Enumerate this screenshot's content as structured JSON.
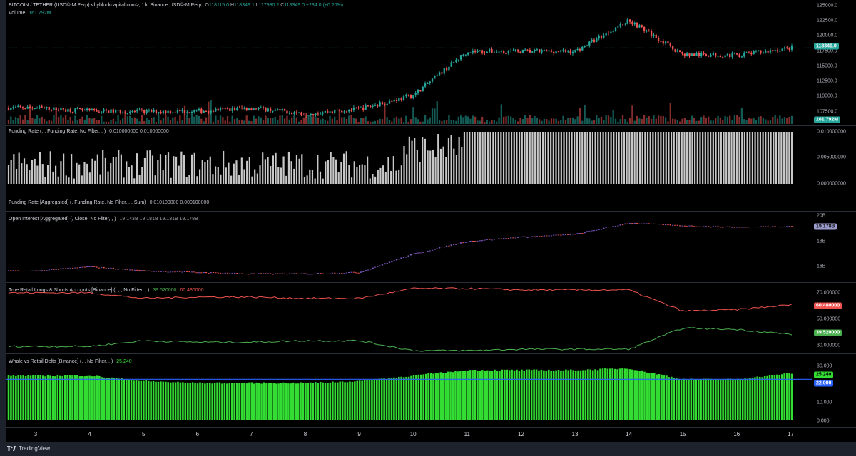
{
  "price_pane": {
    "title": "BITCOIN / TETHER (USD©-M Perp) <hyblockcapital.com>, 1h, Binance USD©-M Perp",
    "ohlc": [
      {
        "label": "O",
        "value": "118115.0"
      },
      {
        "label": "H",
        "value": "118349.1"
      },
      {
        "label": "L",
        "value": "117980.2"
      },
      {
        "label": "C",
        "value": "118349.0"
      }
    ],
    "change": "+234.0 (+0.20%)",
    "volume_label": "Volume",
    "volume_value": "161.792M",
    "ticks": [
      "125000.0",
      "122500.0",
      "120000.0",
      "117500.0",
      "115000.0",
      "112500.0",
      "110000.0",
      "107500.0"
    ],
    "last_price_badge": "118349.0",
    "volume_badge": "161.792M"
  },
  "funding_pane": {
    "title": "Funding Rate (, , Funding Rate, No Filter, , )",
    "values": "0.010000000  0.010000000",
    "ticks": [
      "0.010000000",
      "0.005000000",
      "0.000000000"
    ]
  },
  "agg_funding_pane": {
    "title": "Funding Rate [Aggregated] (, Funding Rate, No Filter, , , Sum)",
    "values": "0.010100000  0.000100000"
  },
  "oi_pane": {
    "title": "Open Interest [Aggregated] (, Close, No Filter, , )",
    "values": "19.143B  19.181B  19.131B  19.178B",
    "ticks": [
      "20B",
      "18B",
      "16B"
    ],
    "badge": "19.178B"
  },
  "retail_pane": {
    "title": "True Retail Longs & Shorts Accounts [Binance] (, , , No Filter, , )",
    "value_green": "39.520000",
    "value_red": "60.480000",
    "ticks": [
      "70.000000",
      "50.000000",
      "30.000000"
    ],
    "badge_red": "60.480000",
    "badge_green": "39.520000"
  },
  "delta_pane": {
    "title": "Whale vs Retail Delta [Binance] (, , No Filter, , )",
    "value": "25.240",
    "ticks": [
      "30.000",
      "10.000",
      "0.000"
    ],
    "badge_value": "25.240",
    "badge_line": "22.000"
  },
  "time_axis": [
    "3",
    "4",
    "5",
    "6",
    "7",
    "8",
    "9",
    "10",
    "11",
    "12",
    "13",
    "14",
    "15",
    "16",
    "17"
  ],
  "branding": "TradingView",
  "colors": {
    "up": "#26a69a",
    "down": "#ef5350",
    "oi_bar": "#7e57c2",
    "retail_long": "#4caf50",
    "retail_short": "#ef5350",
    "delta": "#33dd33",
    "delta_line": "#2962ff"
  },
  "chart_data": [
    {
      "type": "line",
      "title": "BITCOIN / TETHER (USD©-M Perp), 1h",
      "x": [
        "3",
        "4",
        "5",
        "6",
        "7",
        "8",
        "9",
        "10",
        "11",
        "12",
        "13",
        "14",
        "15",
        "16",
        "17"
      ],
      "series": [
        {
          "values": [
            108800,
            108300,
            108200,
            108300,
            108800,
            107900,
            108600,
            110800,
            117800,
            117800,
            117800,
            122800,
            117300,
            117200,
            118349
          ]
        }
      ],
      "ylim": [
        106000,
        126000
      ]
    },
    {
      "type": "line",
      "title": "Open Interest [Aggregated]",
      "x": [
        "3",
        "4",
        "5",
        "6",
        "7",
        "8",
        "9",
        "10",
        "11",
        "12",
        "13",
        "14",
        "15",
        "16",
        "17"
      ],
      "series": [
        {
          "values": [
            16.0,
            16.3,
            16.0,
            15.9,
            15.8,
            15.8,
            15.9,
            17.2,
            18.1,
            18.4,
            18.6,
            19.4,
            19.2,
            19.1,
            19.178
          ]
        }
      ],
      "ylim": [
        15.2,
        20.2
      ]
    },
    {
      "type": "line",
      "title": "True Retail Longs & Shorts Accounts [Binance]",
      "x": [
        "3",
        "4",
        "5",
        "6",
        "7",
        "8",
        "9",
        "10",
        "11",
        "12",
        "13",
        "14",
        "15",
        "16",
        "17"
      ],
      "series": [
        {
          "values": [
            69,
            69,
            65,
            66,
            66,
            65,
            65,
            72,
            72,
            71,
            71,
            71,
            56,
            57,
            60.48
          ]
        },
        {
          "values": [
            31,
            31,
            35,
            34,
            34,
            35,
            35,
            28,
            28,
            29,
            29,
            29,
            44,
            43,
            39.52
          ]
        }
      ],
      "ylim": [
        26,
        76
      ]
    },
    {
      "type": "bar",
      "title": "Whale vs Retail Delta [Binance]",
      "x": [
        "3",
        "4",
        "5",
        "6",
        "7",
        "8",
        "9",
        "10",
        "11",
        "12",
        "13",
        "14",
        "15",
        "16",
        "17"
      ],
      "series": [
        {
          "values": [
            24,
            24,
            21,
            20,
            20,
            20,
            21,
            24,
            27,
            27,
            27,
            28,
            22,
            22,
            25.24
          ]
        }
      ],
      "reference_line": 22,
      "ylim": [
        0,
        33
      ]
    }
  ]
}
